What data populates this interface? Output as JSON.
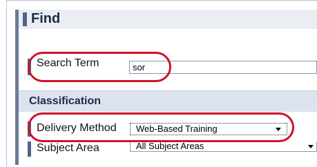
{
  "panel": {
    "title": "Find"
  },
  "search": {
    "label": "Search Term",
    "value": "sor"
  },
  "classification": {
    "title": "Classification",
    "delivery_method": {
      "label": "Delivery Method",
      "selected": "Web-Based Training"
    },
    "subject_area": {
      "label": "Subject Area",
      "selected": "All Subject Areas"
    }
  },
  "colors": {
    "highlight": "#d0102a",
    "accent": "#4f6387",
    "header_bg": "#eaeef4",
    "section_bg": "#dde3ee"
  }
}
